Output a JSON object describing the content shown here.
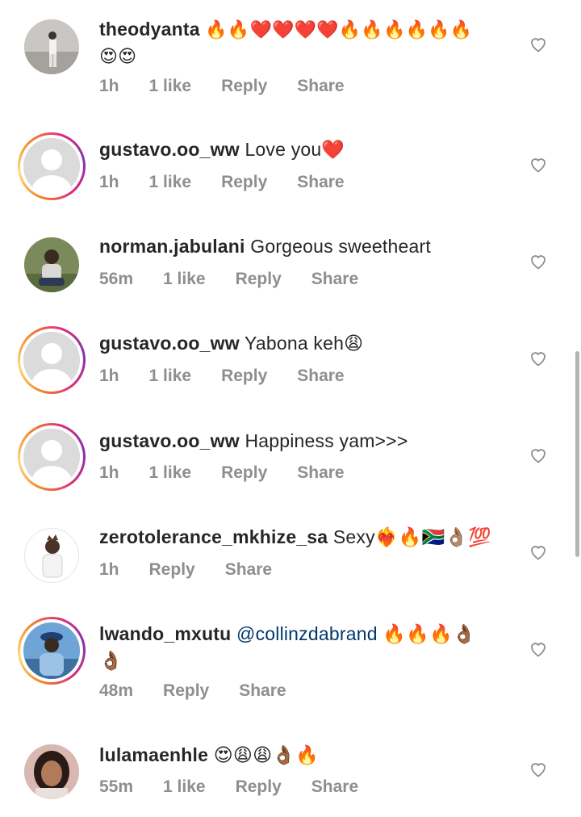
{
  "comments": [
    {
      "username": "theodyanta",
      "text": "🔥🔥❤️❤️❤️❤️🔥🔥🔥🔥🔥🔥",
      "text2": "😍😍",
      "time": "1h",
      "likes": "1 like",
      "reply": "Reply",
      "share": "Share",
      "avatar_style": "photo",
      "story_ring": false
    },
    {
      "username": "gustavo.oo_ww",
      "text": "Love you❤️",
      "time": "1h",
      "likes": "1 like",
      "reply": "Reply",
      "share": "Share",
      "avatar_style": "default",
      "story_ring": true
    },
    {
      "username": "norman.jabulani",
      "text": "Gorgeous sweetheart",
      "time": "56m",
      "likes": "1 like",
      "reply": "Reply",
      "share": "Share",
      "avatar_style": "photo",
      "story_ring": false
    },
    {
      "username": "gustavo.oo_ww",
      "text": "Yabona keh😩",
      "time": "1h",
      "likes": "1 like",
      "reply": "Reply",
      "share": "Share",
      "avatar_style": "default",
      "story_ring": true
    },
    {
      "username": "gustavo.oo_ww",
      "text": "Happiness yam>>>",
      "time": "1h",
      "likes": "1 like",
      "reply": "Reply",
      "share": "Share",
      "avatar_style": "default",
      "story_ring": true
    },
    {
      "username": "zerotolerance_mkhize_sa",
      "text": "Sexy❤️‍🔥🔥🇿🇦👌🏽💯",
      "time": "1h",
      "reply": "Reply",
      "share": "Share",
      "avatar_style": "photo",
      "story_ring": false
    },
    {
      "username": "lwando_mxutu",
      "mention": "@collinzdabrand",
      "text": "🔥🔥🔥👌🏾",
      "text2": "👌🏾",
      "time": "48m",
      "reply": "Reply",
      "share": "Share",
      "avatar_style": "photo",
      "story_ring": true
    },
    {
      "username": "lulamaenhle",
      "text": "😍😩😩👌🏾🔥",
      "time": "55m",
      "likes": "1 like",
      "reply": "Reply",
      "share": "Share",
      "avatar_style": "photo",
      "story_ring": false
    }
  ],
  "icons": {
    "like": "heart-outline-icon"
  },
  "colors": {
    "username": "#262626",
    "meta": "#8e8e8e",
    "mention": "#00376b",
    "heart_outline": "#8e8e8e"
  }
}
